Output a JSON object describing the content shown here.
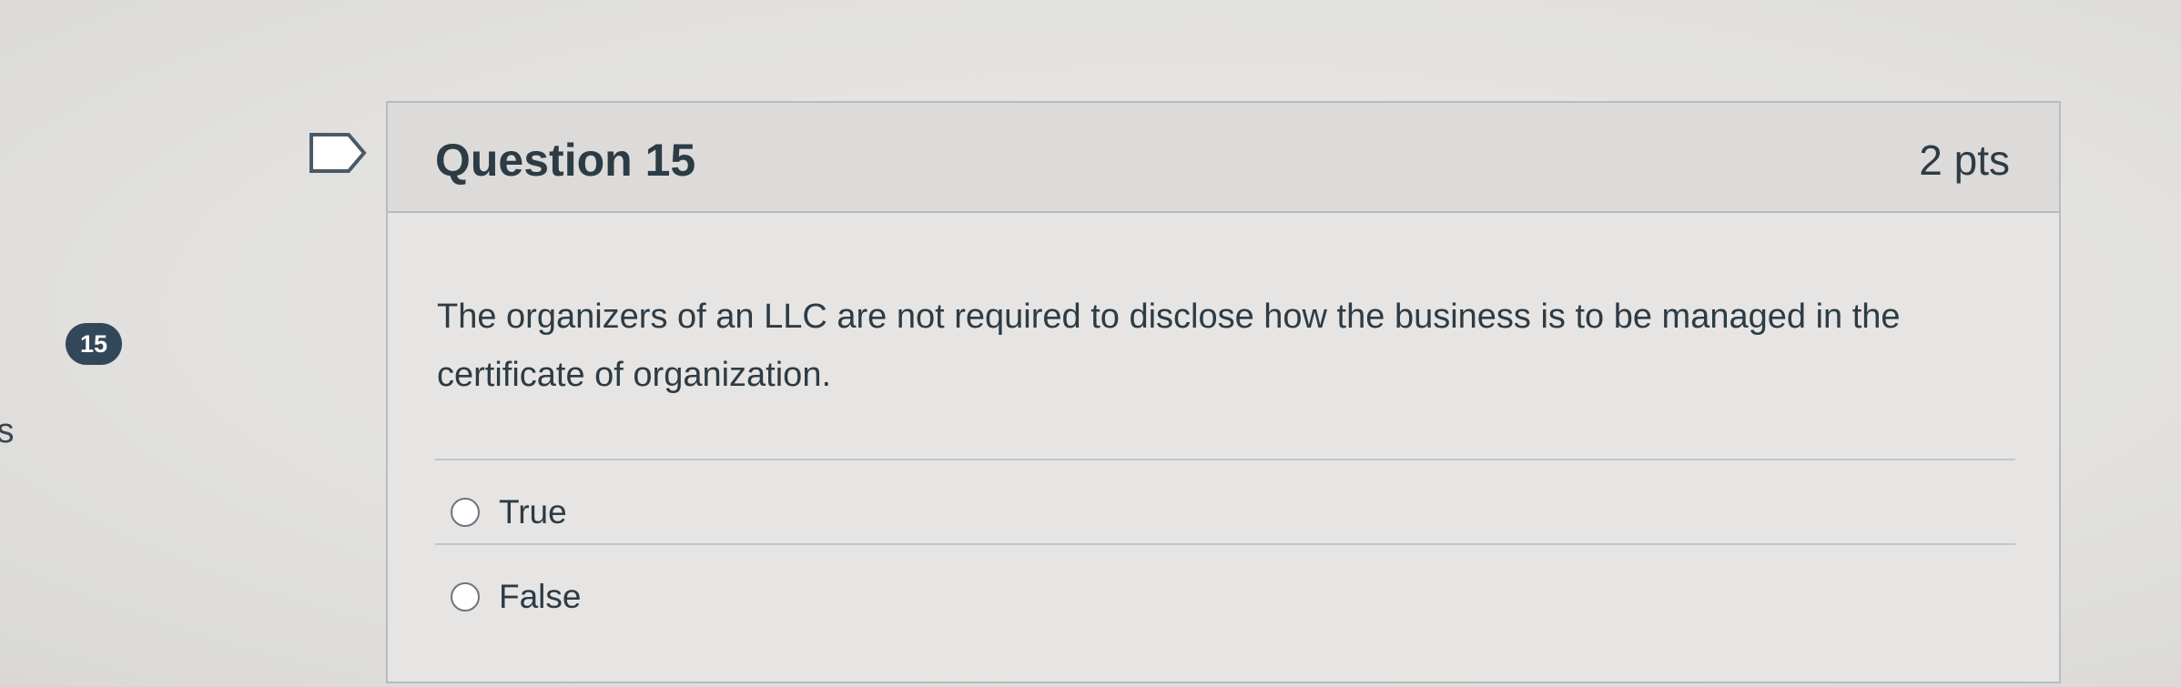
{
  "side_nav": {
    "question_badge": "15",
    "side_text": "ts"
  },
  "question": {
    "title": "Question 15",
    "points": "2 pts",
    "text": "The organizers of an LLC are not required to disclose how the business is to be managed in the certificate of organization.",
    "answers": [
      {
        "label": "True",
        "selected": false
      },
      {
        "label": "False",
        "selected": false
      }
    ]
  },
  "icons": {
    "flag": "flag-question-icon",
    "radio": "radio-unchecked-icon"
  },
  "colors": {
    "badge_bg": "#33475a",
    "text": "#2d3b45",
    "border": "#b8bcbf"
  }
}
